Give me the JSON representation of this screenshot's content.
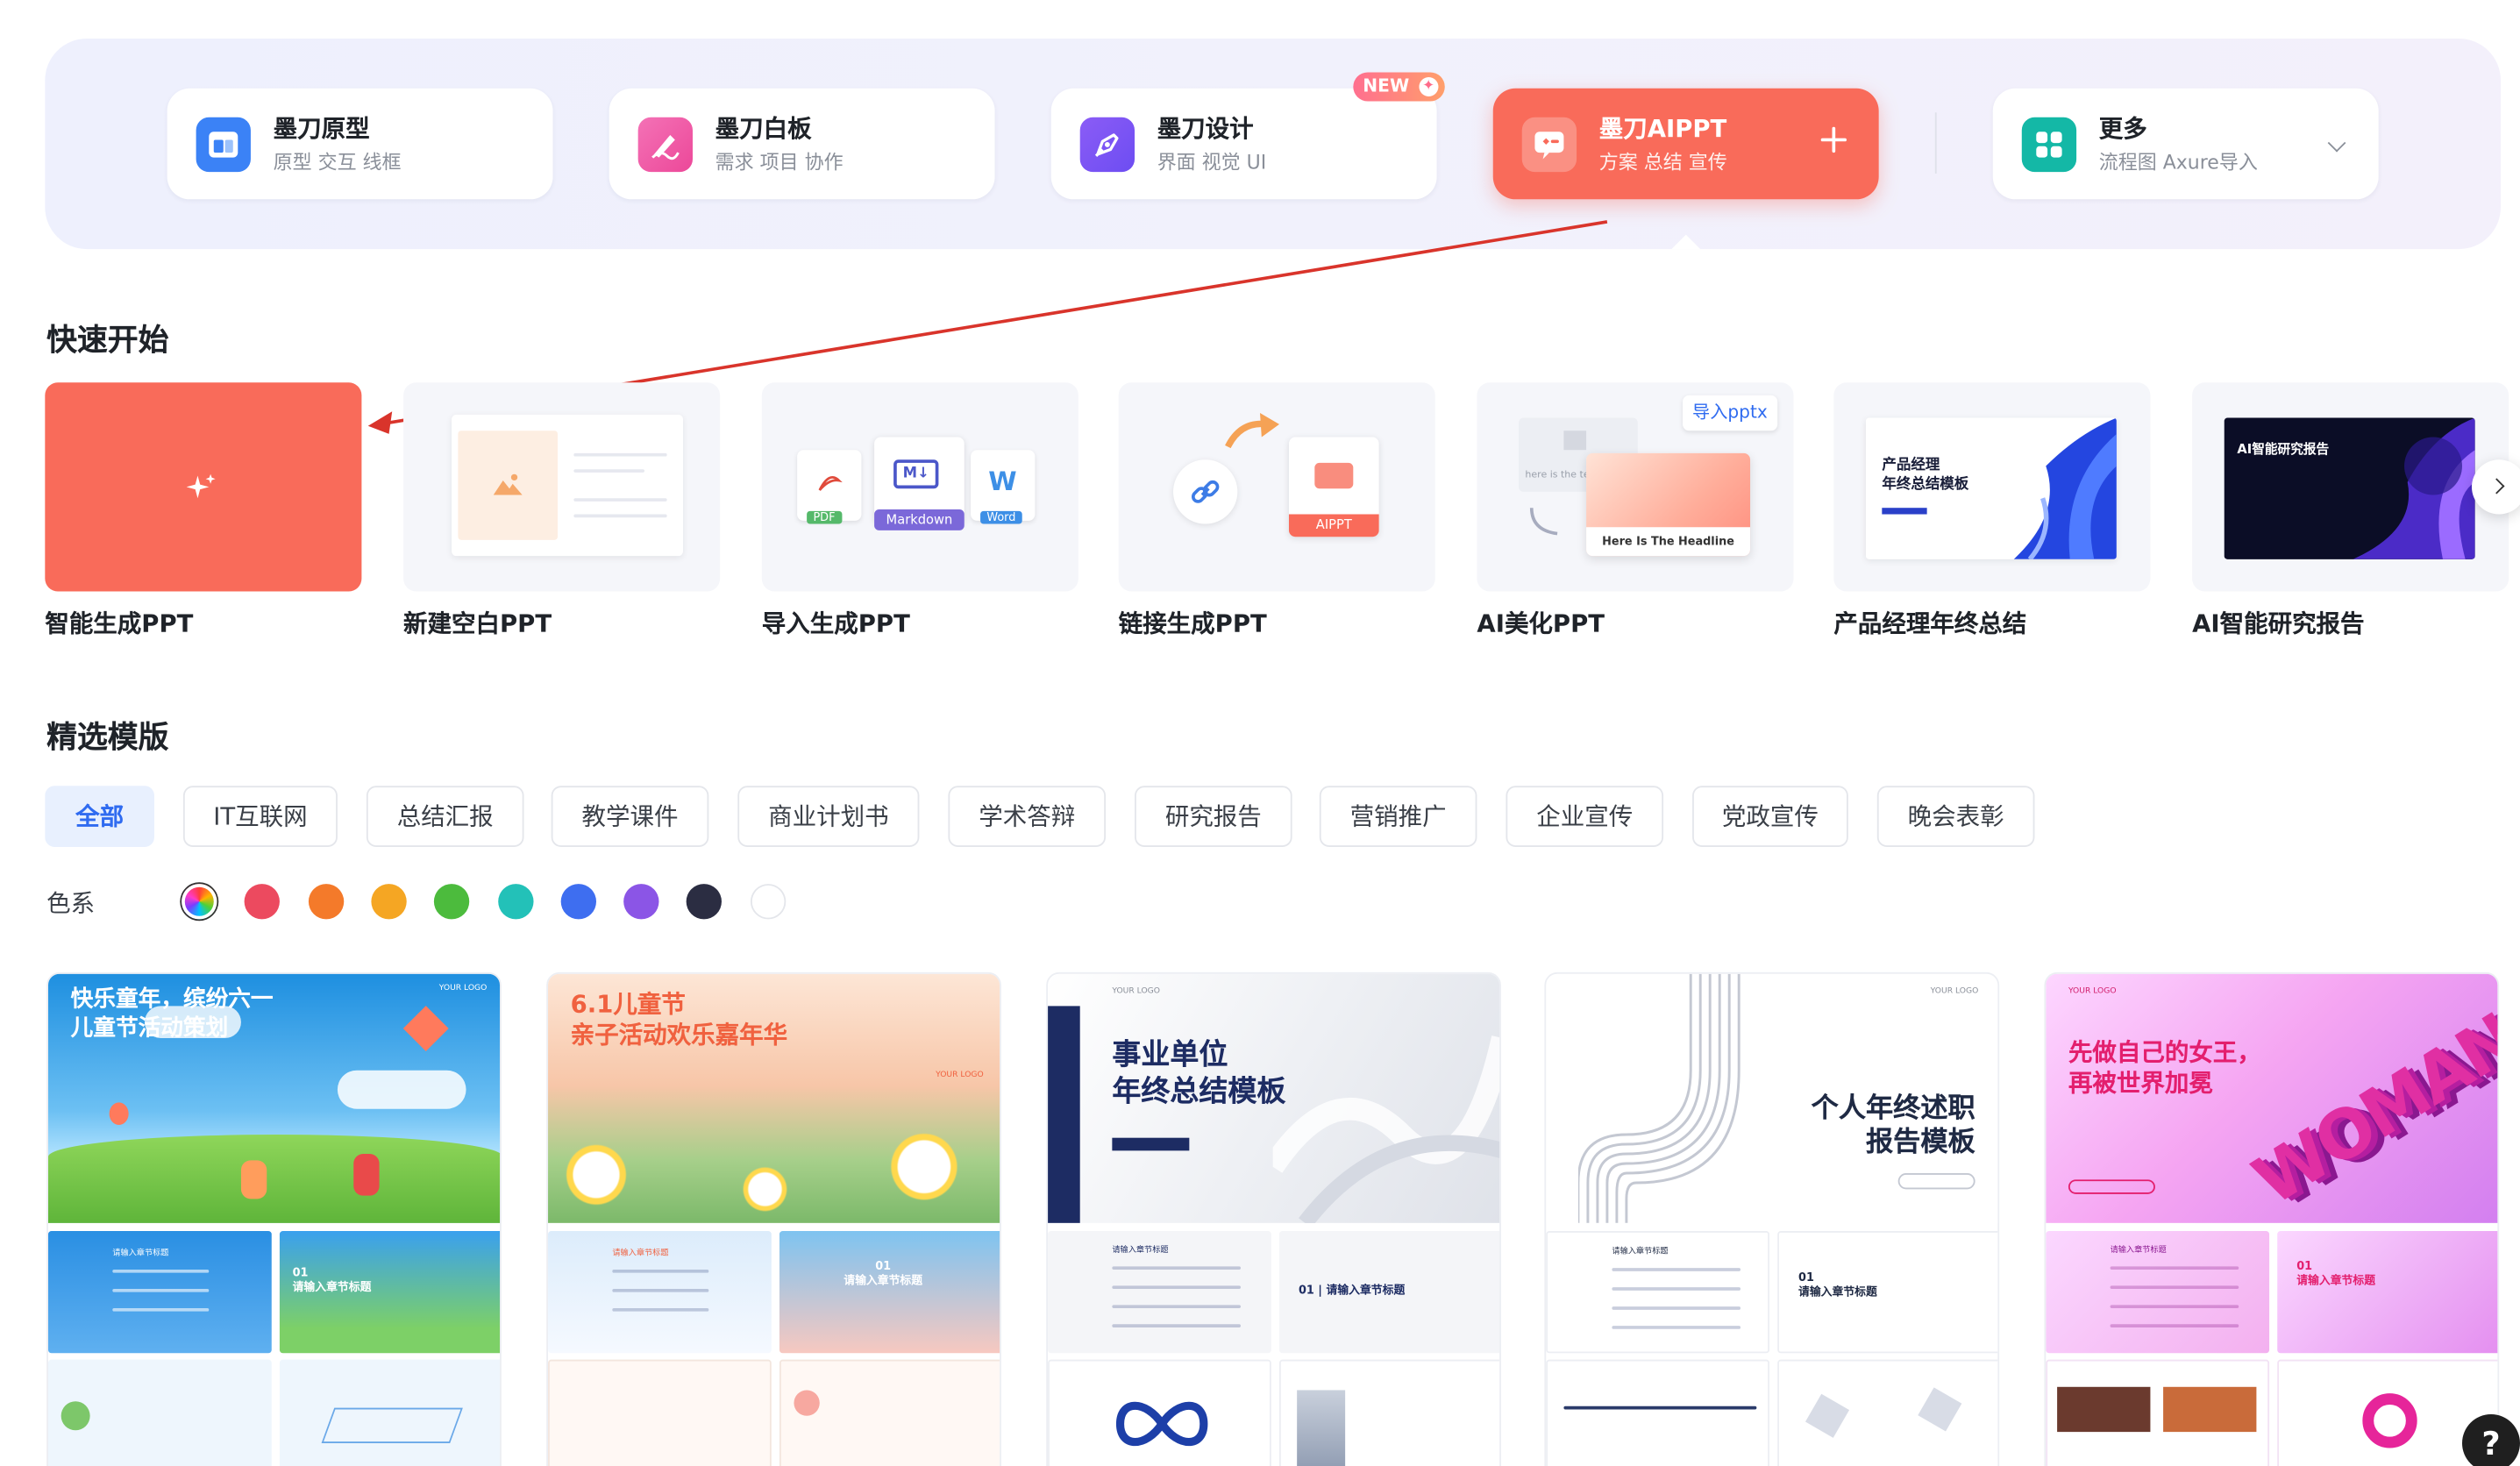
{
  "apps": [
    {
      "name": "墨刀原型",
      "sub": "原型 交互 线框",
      "icon": "prototype-icon",
      "color": "#3b82f6"
    },
    {
      "name": "墨刀白板",
      "sub": "需求 项目 协作",
      "icon": "whiteboard-icon",
      "color": "#ec4899"
    },
    {
      "name": "墨刀设计",
      "sub": "界面 视觉 UI",
      "icon": "design-pen-icon",
      "color": "#7c5cf6",
      "badge": "NEW"
    },
    {
      "name": "墨刀AIPPT",
      "sub": "方案 总结 宣传",
      "icon": "aippt-icon",
      "color": "#f96b5a"
    },
    {
      "name": "更多",
      "sub": "流程图 Axure导入",
      "icon": "grid-apps-icon",
      "color": "#14b8a6"
    }
  ],
  "quick_start": {
    "title": "快速开始",
    "items": [
      {
        "label": "智能生成PPT"
      },
      {
        "label": "新建空白PPT"
      },
      {
        "label": "导入生成PPT",
        "chips": [
          "PDF",
          "Markdown",
          "Word"
        ]
      },
      {
        "label": "链接生成PPT",
        "chip": "AIPPT"
      },
      {
        "label": "AI美化PPT",
        "badge": "导入pptx",
        "headline": "Here Is The Headline",
        "subtext": "here is the text"
      },
      {
        "label": "产品经理年终总结",
        "cover_title": "产品经理\n年终总结模板"
      },
      {
        "label": "AI智能研究报告",
        "cover_title": "AI智能研究报告"
      }
    ]
  },
  "templates_section": {
    "title": "精选模版",
    "tabs": [
      "全部",
      "IT互联网",
      "总结汇报",
      "教学课件",
      "商业计划书",
      "学术答辩",
      "研究报告",
      "营销推广",
      "企业宣传",
      "党政宣传",
      "晚会表彰"
    ],
    "active_tab": "全部",
    "color_label": "色系",
    "colors": [
      "rainbow",
      "#ec4a5f",
      "#f47a2a",
      "#f5a623",
      "#4cbb3d",
      "#23c1b8",
      "#3e6ef0",
      "#8b55e6",
      "#2b2d42",
      "#ffffff"
    ]
  },
  "templates": [
    {
      "title": "快乐童年，缤纷六一\n儿童节活动策划",
      "logo": "YOUR LOGO",
      "item": "请输入章节标题",
      "section": "01\n请输入章节标题"
    },
    {
      "title": "6.1儿童节\n亲子活动欢乐嘉年华",
      "logo": "YOUR LOGO",
      "item": "请输入章节标题",
      "section": "01\n请输入章节标题"
    },
    {
      "title": "事业单位\n年终总结模板",
      "logo": "YOUR LOGO",
      "item": "请输入章节标题",
      "section": "01 | 请输入章节标题"
    },
    {
      "title": "个人年终述职\n报告模板",
      "logo": "YOUR LOGO",
      "item": "请输入章节标题",
      "section": "01\n请输入章节标题"
    },
    {
      "title": "先做自己的女王，\n再被世界加冕",
      "logo": "YOUR LOGO",
      "item": "请输入章节标题",
      "section": "01\n请输入章节标题",
      "art": "WOMAN"
    }
  ],
  "help_label": "?"
}
